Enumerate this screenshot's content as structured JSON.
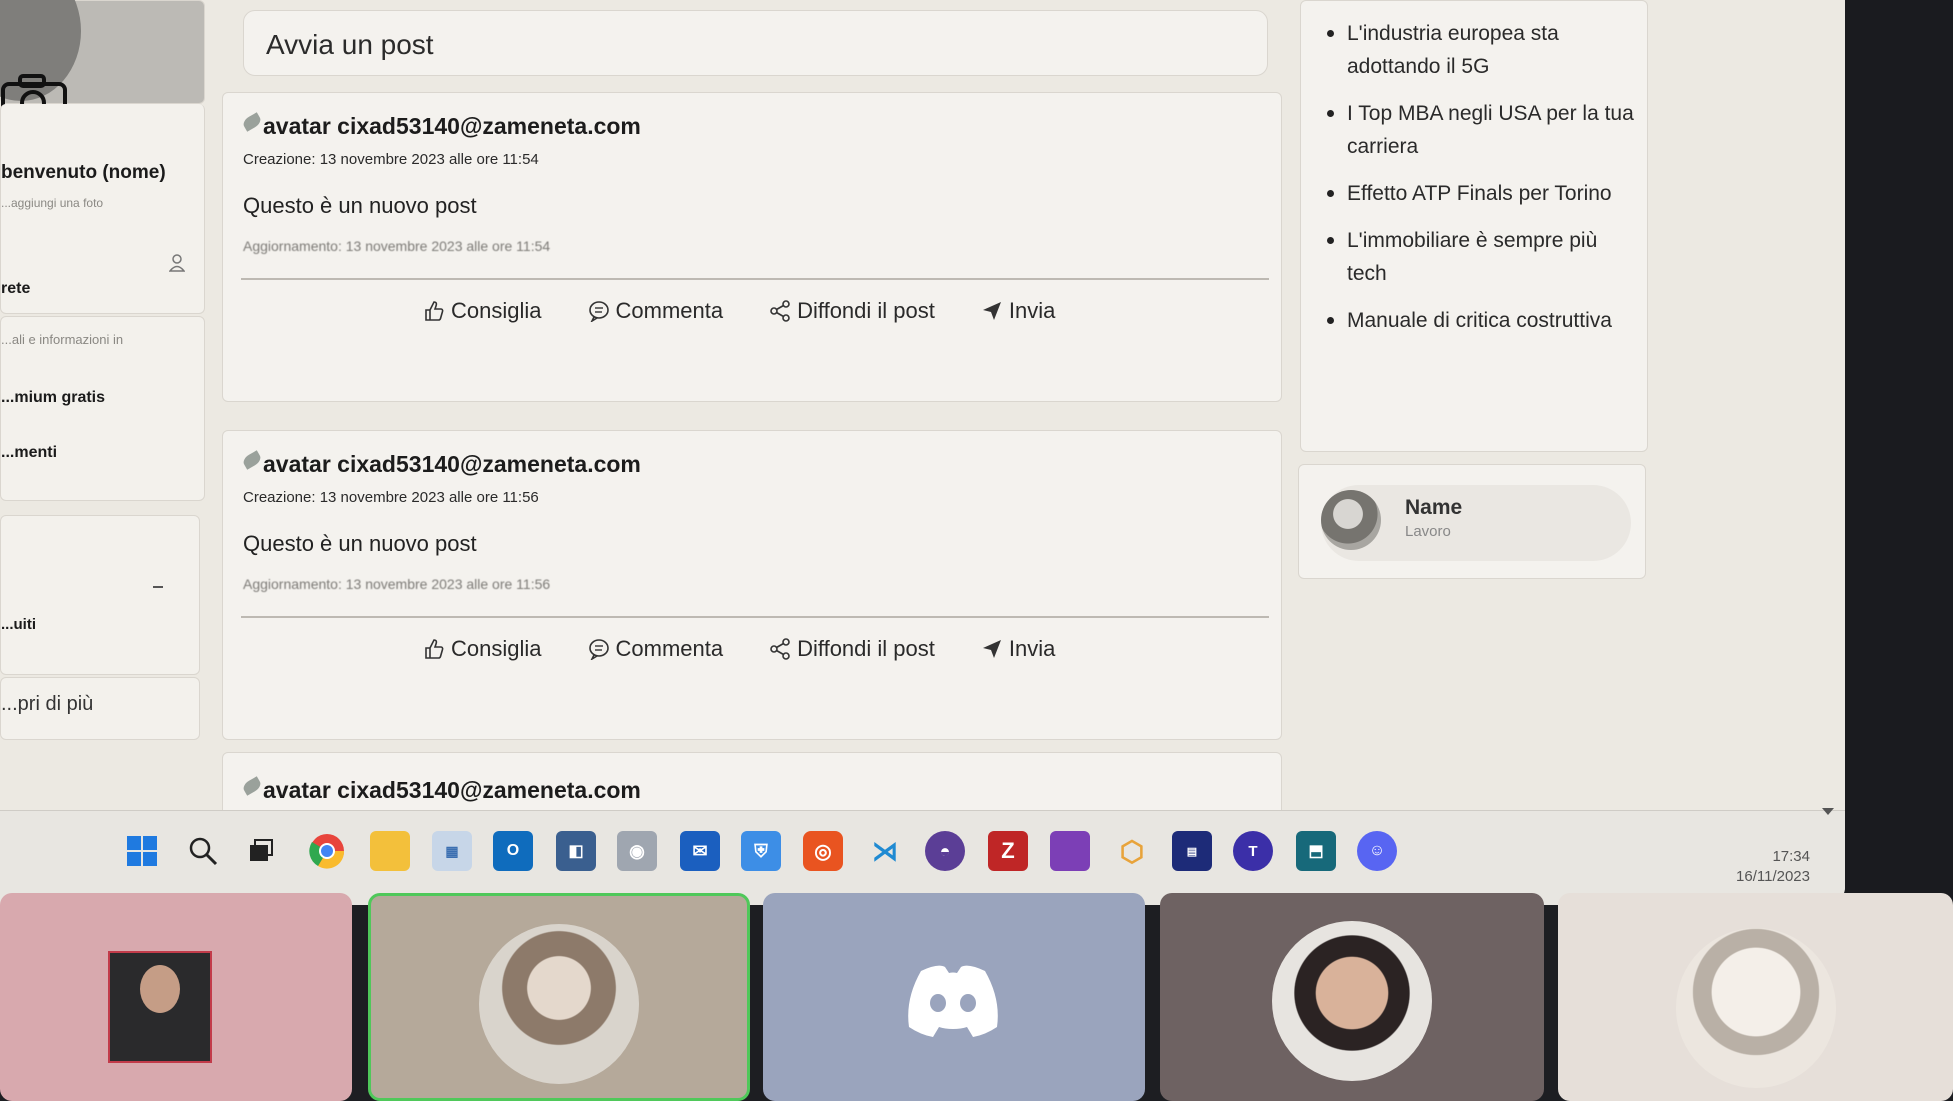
{
  "left_sidebar": {
    "welcome": "benvenuto (nome)",
    "add_photo": "...aggiungi una foto",
    "network": "rete",
    "info_text": "...ali e informazioni in",
    "premium": "...mium gratis",
    "items": "...menti",
    "saved": "...uiti",
    "discover_more": "...pri di più"
  },
  "start_post": {
    "placeholder": "Avvia un post"
  },
  "posts": [
    {
      "author": "avatar cixad53140@zameneta.com",
      "created": "Creazione: 13 novembre 2023 alle ore 11:54",
      "content": "Questo è un nuovo post",
      "updated": "Aggiornamento: 13 novembre 2023 alle ore 11:54"
    },
    {
      "author": "avatar cixad53140@zameneta.com",
      "created": "Creazione: 13 novembre 2023 alle ore 11:56",
      "content": "Questo è un nuovo post",
      "updated": "Aggiornamento: 13 novembre 2023 alle ore 11:56"
    },
    {
      "author": "avatar cixad53140@zameneta.com"
    }
  ],
  "actions": {
    "like": "Consiglia",
    "comment": "Commenta",
    "share": "Diffondi il post",
    "send": "Invia"
  },
  "news": [
    "L'industria europea sta adottando il 5G",
    "I Top MBA negli USA per la tua carriera",
    "Effetto ATP Finals per Torino",
    "L'immobiliare è sempre più tech",
    "Manuale di critica costruttiva"
  ],
  "suggestion": {
    "name": "Name",
    "role": "Lavoro"
  },
  "taskbar": {
    "icons": [
      "windows-start-icon",
      "search-icon",
      "task-view-icon",
      "chrome-icon",
      "file-explorer-icon",
      "photos-icon",
      "outlook-icon",
      "app-icon",
      "camera-icon",
      "mail-icon",
      "security-icon",
      "ubuntu-icon",
      "vscode-icon",
      "github-icon",
      "filezilla-icon",
      "app-icon",
      "app-icon",
      "app-icon",
      "teams-icon",
      "app-icon",
      "discord-icon"
    ],
    "time": "17:34",
    "date": "16/11/2023"
  },
  "video_tiles": [
    "participant-1",
    "participant-2",
    "discord",
    "participant-4",
    "participant-5"
  ]
}
